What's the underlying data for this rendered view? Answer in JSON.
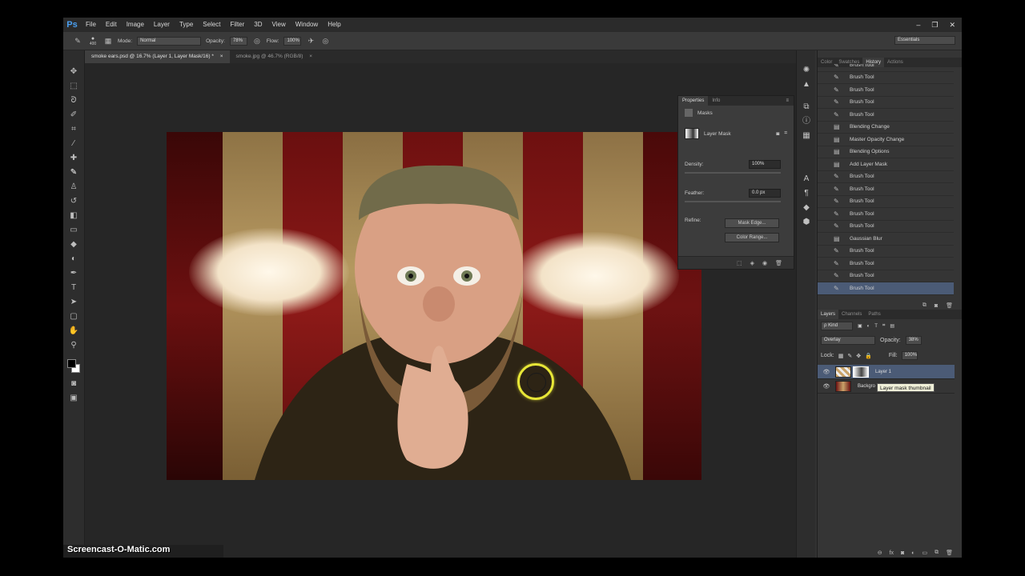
{
  "menu": {
    "logo": "Ps",
    "items": [
      "File",
      "Edit",
      "Image",
      "Layer",
      "Type",
      "Select",
      "Filter",
      "3D",
      "View",
      "Window",
      "Help"
    ],
    "window_controls": [
      "–",
      "❐",
      "✕"
    ]
  },
  "options": {
    "brush_size": "400",
    "mode_label": "Mode:",
    "mode_value": "Normal",
    "opacity_label": "Opacity:",
    "opacity_value": "78%",
    "flow_label": "Flow:",
    "flow_value": "100%",
    "workspace": "Essentials"
  },
  "tabs": [
    {
      "label": "smoke ears.psd @ 16.7% (Layer 1, Layer Mask/16) *",
      "close": "×"
    },
    {
      "label": "smoke.jpg @ 46.7% (RGB/8)",
      "close": "×"
    }
  ],
  "properties": {
    "tabs": [
      "Properties",
      "Info"
    ],
    "section": "Masks",
    "mask_type": "Layer Mask",
    "density_label": "Density:",
    "density_value": "100%",
    "feather_label": "Feather:",
    "feather_value": "0.0 px",
    "refine_label": "Refine:",
    "mask_edge_btn": "Mask Edge...",
    "color_range_btn": "Color Range..."
  },
  "history": {
    "tabs": [
      "Color",
      "Swatches",
      "History",
      "Actions"
    ],
    "items": [
      {
        "label": "Brush Tool",
        "icon": "brush-icon"
      },
      {
        "label": "Brush Tool",
        "icon": "brush-icon"
      },
      {
        "label": "Brush Tool",
        "icon": "brush-icon"
      },
      {
        "label": "Brush Tool",
        "icon": "brush-icon"
      },
      {
        "label": "Brush Tool",
        "icon": "brush-icon"
      },
      {
        "label": "Blending Change",
        "icon": "layer-icon"
      },
      {
        "label": "Master Opacity Change",
        "icon": "layer-icon"
      },
      {
        "label": "Blending Options",
        "icon": "layer-icon"
      },
      {
        "label": "Add Layer Mask",
        "icon": "layer-icon"
      },
      {
        "label": "Brush Tool",
        "icon": "brush-icon"
      },
      {
        "label": "Brush Tool",
        "icon": "brush-icon"
      },
      {
        "label": "Brush Tool",
        "icon": "brush-icon"
      },
      {
        "label": "Brush Tool",
        "icon": "brush-icon"
      },
      {
        "label": "Brush Tool",
        "icon": "brush-icon"
      },
      {
        "label": "Gaussian Blur",
        "icon": "layer-icon"
      },
      {
        "label": "Brush Tool",
        "icon": "brush-icon"
      },
      {
        "label": "Brush Tool",
        "icon": "brush-icon"
      },
      {
        "label": "Brush Tool",
        "icon": "brush-icon"
      },
      {
        "label": "Brush Tool",
        "icon": "brush-icon"
      }
    ],
    "selected_index": 18
  },
  "layers": {
    "tabs": [
      "Layers",
      "Channels",
      "Paths"
    ],
    "filter_label": "ρ Kind",
    "blend_mode": "Overlay",
    "opacity_label": "Opacity:",
    "opacity_value": "38%",
    "lock_label": "Lock:",
    "fill_label": "Fill:",
    "fill_value": "100%",
    "rows": [
      {
        "name": "Layer 1",
        "selected": true
      },
      {
        "name": "Backgro",
        "selected": false
      }
    ],
    "tooltip": "Layer mask thumbnail"
  },
  "watermark": "Screencast-O-Matic.com",
  "colors": {
    "accent": "#4a9ff0",
    "selection": "#4b5b76",
    "cursor_ring": "#e7e637"
  }
}
